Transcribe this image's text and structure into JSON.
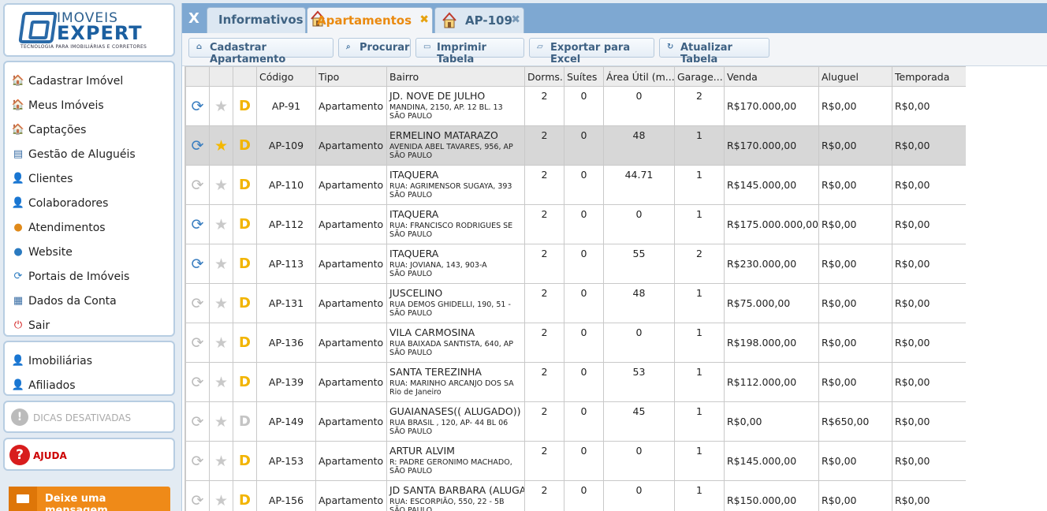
{
  "logo": {
    "line1": "IMOVEIS",
    "line2": "EXPERT",
    "sub": "TECNOLOGIA PARA IMOBILIÁRIAS E CORRETORES"
  },
  "menu": [
    {
      "label": "Cadastrar Imóvel",
      "icon": "house-icon"
    },
    {
      "label": "Meus Imóveis",
      "icon": "house-icon"
    },
    {
      "label": "Captações",
      "icon": "house-icon"
    },
    {
      "label": "Gestão de Aluguéis",
      "icon": "document-icon"
    },
    {
      "label": "Clientes",
      "icon": "user-icon"
    },
    {
      "label": "Colaboradores",
      "icon": "user-icon"
    },
    {
      "label": "Atendimentos",
      "icon": "chat-icon"
    },
    {
      "label": "Website",
      "icon": "globe-icon"
    },
    {
      "label": "Portais de Imóveis",
      "icon": "sync-icon"
    },
    {
      "label": "Dados da Conta",
      "icon": "account-icon"
    },
    {
      "label": "Sair",
      "icon": "power-icon"
    }
  ],
  "menu2": [
    {
      "label": "Imobiliárias",
      "icon": "agent-icon"
    },
    {
      "label": "Afiliados",
      "icon": "user-icon"
    }
  ],
  "tips": {
    "icon": "!",
    "label": "DICAS DESATIVADAS"
  },
  "help": {
    "icon": "?",
    "label": "AJUDA"
  },
  "message_button": "Deixe uma mensagem",
  "tabs": {
    "close_all": "X",
    "info": "Informativos",
    "apartments": "Apartamentos",
    "detail": "AP-109",
    "close": "✖"
  },
  "toolbar": {
    "register": "Cadastrar Apartamento",
    "search": "Procurar",
    "print": "Imprimir Tabela",
    "export": "Exportar para Excel",
    "refresh": "Atualizar Tabela"
  },
  "columns": [
    "Código",
    "Tipo",
    "Bairro",
    "Dorms.",
    "Suítes",
    "Área Útil (m...",
    "Garage...",
    "Venda",
    "Aluguel",
    "Temporada"
  ],
  "rows": [
    {
      "sync": true,
      "fav": false,
      "d": true,
      "code": "AP-91",
      "type": "Apartamento",
      "b1": "JD. NOVE DE JULHO",
      "b2": "MANDINA, 2150, AP. 12 BL. 13",
      "b3": "SÃO PAULO",
      "dorms": "2",
      "suites": "0",
      "area": "0",
      "garage": "2",
      "venda": "R$170.000,00",
      "aluguel": "R$0,00",
      "temporada": "R$0,00"
    },
    {
      "sync": true,
      "fav": true,
      "d": true,
      "code": "AP-109",
      "type": "Apartamento",
      "b1": "ERMELINO MATARAZO",
      "b2": "AVENIDA ABEL TAVARES, 956, AP",
      "b3": "SÃO PAULO",
      "dorms": "2",
      "suites": "0",
      "area": "48",
      "garage": "1",
      "venda": "R$170.000,00",
      "aluguel": "R$0,00",
      "temporada": "R$0,00"
    },
    {
      "sync": false,
      "fav": false,
      "d": true,
      "code": "AP-110",
      "type": "Apartamento",
      "b1": "ITAQUERA",
      "b2": "RUA: AGRIMENSOR SUGAYA, 393",
      "b3": "SÃO PAULO",
      "dorms": "2",
      "suites": "0",
      "area": "44.71",
      "garage": "1",
      "venda": "R$145.000,00",
      "aluguel": "R$0,00",
      "temporada": "R$0,00"
    },
    {
      "sync": true,
      "fav": false,
      "d": true,
      "code": "AP-112",
      "type": "Apartamento",
      "b1": "ITAQUERA",
      "b2": "RUA: FRANCISCO RODRIGUES SE",
      "b3": "SÃO PAULO",
      "dorms": "2",
      "suites": "0",
      "area": "0",
      "garage": "1",
      "venda": "R$175.000.000,00",
      "aluguel": "R$0,00",
      "temporada": "R$0,00"
    },
    {
      "sync": true,
      "fav": false,
      "d": true,
      "code": "AP-113",
      "type": "Apartamento",
      "b1": "ITAQUERA",
      "b2": "RUA: JOVIANA, 143, 903-A",
      "b3": "SÃO PAULO",
      "dorms": "2",
      "suites": "0",
      "area": "55",
      "garage": "2",
      "venda": "R$230.000,00",
      "aluguel": "R$0,00",
      "temporada": "R$0,00"
    },
    {
      "sync": false,
      "fav": false,
      "d": true,
      "code": "AP-131",
      "type": "Apartamento",
      "b1": "JUSCELINO",
      "b2": "RUA DEMOS GHIDELLI, 190, 51 -",
      "b3": "SÃO PAULO",
      "dorms": "2",
      "suites": "0",
      "area": "48",
      "garage": "1",
      "venda": "R$75.000,00",
      "aluguel": "R$0,00",
      "temporada": "R$0,00"
    },
    {
      "sync": false,
      "fav": false,
      "d": true,
      "code": "AP-136",
      "type": "Apartamento",
      "b1": "VILA CARMOSINA",
      "b2": "RUA BAIXADA SANTISTA, 640, AP",
      "b3": "SÃO PAULO",
      "dorms": "2",
      "suites": "0",
      "area": "0",
      "garage": "1",
      "venda": "R$198.000,00",
      "aluguel": "R$0,00",
      "temporada": "R$0,00"
    },
    {
      "sync": false,
      "fav": false,
      "d": true,
      "code": "AP-139",
      "type": "Apartamento",
      "b1": "SANTA TEREZINHA",
      "b2": "RUA: MARINHO ARCANJO DOS SA",
      "b3": "Rio de Janeiro",
      "dorms": "2",
      "suites": "0",
      "area": "53",
      "garage": "1",
      "venda": "R$112.000,00",
      "aluguel": "R$0,00",
      "temporada": "R$0,00"
    },
    {
      "sync": false,
      "fav": false,
      "d": false,
      "code": "AP-149",
      "type": "Apartamento",
      "b1": "GUAIANASES(( ALUGADO))",
      "b2": "RUA BRASIL , 120, AP- 44 BL 06",
      "b3": "SÃO PAULO",
      "dorms": "2",
      "suites": "0",
      "area": "45",
      "garage": "1",
      "venda": "R$0,00",
      "aluguel": "R$650,00",
      "temporada": "R$0,00"
    },
    {
      "sync": false,
      "fav": false,
      "d": true,
      "code": "AP-153",
      "type": "Apartamento",
      "b1": "ARTUR ALVIM",
      "b2": "R: PADRE GERONIMO MACHADO,",
      "b3": "SÃO PAULO",
      "dorms": "2",
      "suites": "0",
      "area": "0",
      "garage": "1",
      "venda": "R$145.000,00",
      "aluguel": "R$0,00",
      "temporada": "R$0,00"
    },
    {
      "sync": false,
      "fav": false,
      "d": true,
      "code": "AP-156",
      "type": "Apartamento",
      "b1": "JD SANTA BARBARA (ALUGA",
      "b2": "RUA: ESCORPIÃO, 550, 22 - 5B",
      "b3": "SÃO PAULO",
      "dorms": "2",
      "suites": "0",
      "area": "0",
      "garage": "1",
      "venda": "R$150.000,00",
      "aluguel": "R$0,00",
      "temporada": "R$0,00"
    }
  ],
  "selected_row": 1
}
